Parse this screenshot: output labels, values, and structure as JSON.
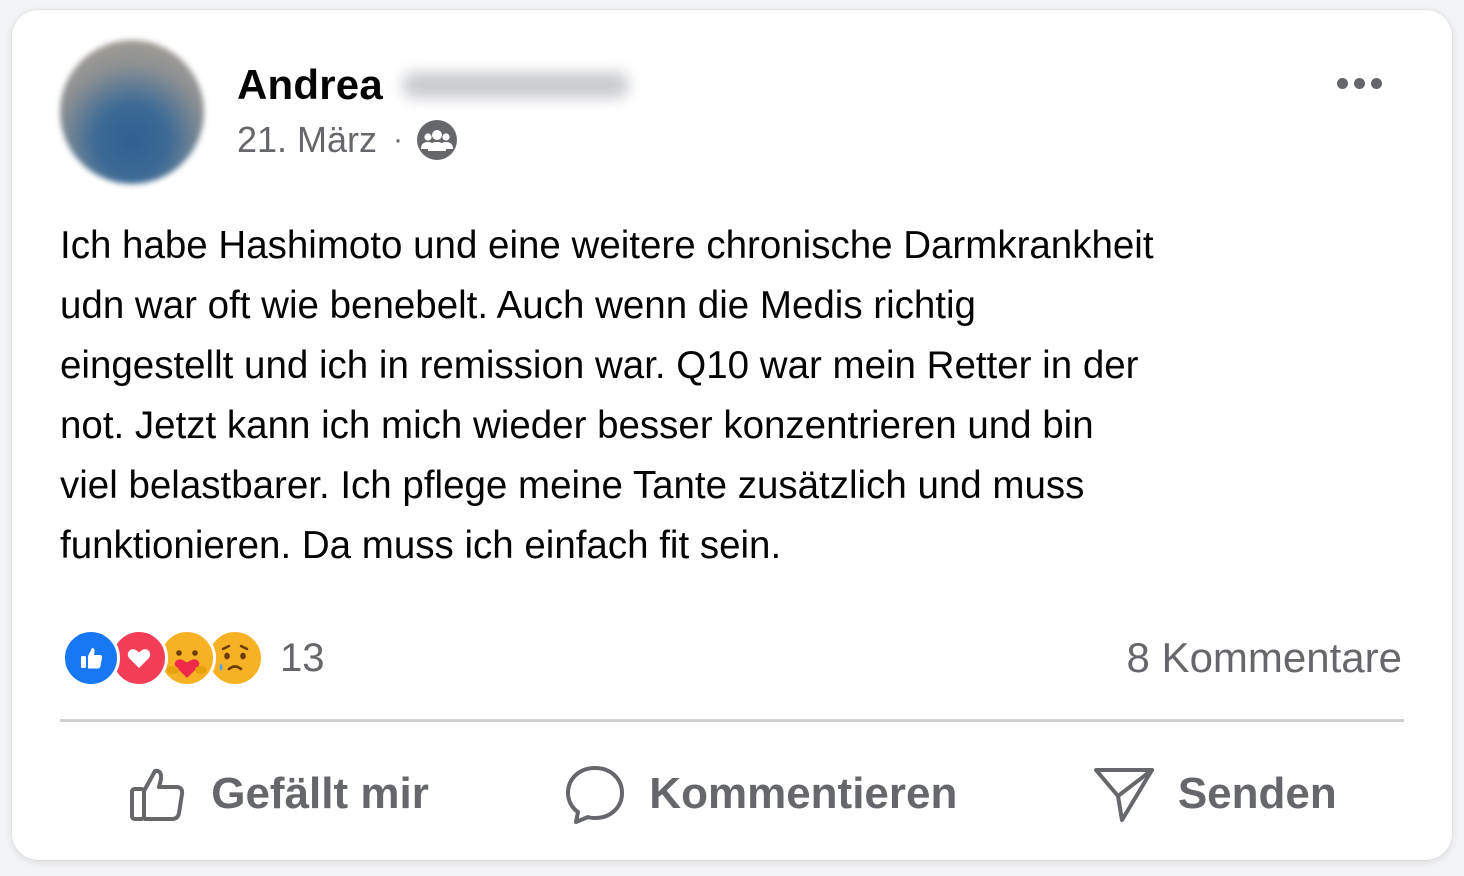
{
  "post": {
    "author_name": "Andrea",
    "date": "21. März",
    "separator": "·",
    "audience_icon": "friends-group-icon",
    "more_icon": "more-horizontal-icon",
    "text": "Ich habe Hashimoto und eine weitere chronische Darmkrankheit\nudn war oft wie benebelt. Auch wenn die Medis richtig\neingestellt und ich in remission war. Q10 war mein Retter in der\nnot. Jetzt kann ich mich wieder besser konzentrieren und bin\nviel belastbarer. Ich pflege meine Tante zusätzlich und muss\nfunktionieren. Da muss ich einfach fit sein."
  },
  "reactions": {
    "icons": [
      "like-reaction-icon",
      "love-reaction-icon",
      "care-reaction-icon",
      "sad-reaction-icon"
    ],
    "count": "13",
    "comments_label": "8 Kommentare"
  },
  "actions": {
    "like_label": "Gefällt mir",
    "comment_label": "Kommentieren",
    "send_label": "Senden"
  },
  "colors": {
    "like_blue": "#1877f2",
    "love_red": "#f33e58",
    "emoji_yellow": "#f7b125",
    "secondary_text": "#65676b",
    "primary_text": "#050505"
  }
}
